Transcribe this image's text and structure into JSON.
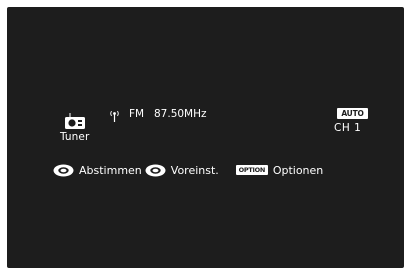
{
  "tuner": {
    "source_label": "Tuner",
    "source_icon": "radio-icon",
    "signal_icon": "antenna-signal-icon",
    "band": "FM",
    "frequency": "87.50MHz"
  },
  "preset": {
    "mode_badge": "AUTO",
    "channel": "CH 1"
  },
  "hints": [
    {
      "icon": "knob-icon",
      "label": "Abstimmen"
    },
    {
      "icon": "knob-icon",
      "label": "Voreinst."
    },
    {
      "icon": "option-button-icon",
      "badge": "OPTION",
      "label": "Optionen"
    }
  ],
  "colors": {
    "screen_background": "#1d1d1d",
    "text": "#ffffff",
    "page_background": "#ffffff"
  }
}
